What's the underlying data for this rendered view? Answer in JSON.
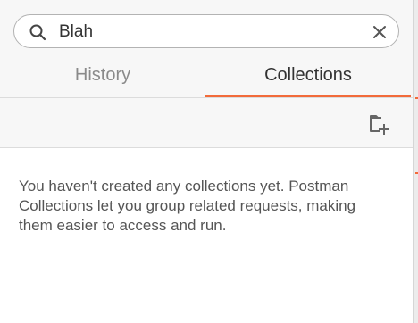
{
  "search": {
    "value": "Blah",
    "icon": "search-icon",
    "clear_icon": "close-icon"
  },
  "tabs": [
    {
      "label": "History",
      "active": false
    },
    {
      "label": "Collections",
      "active": true
    }
  ],
  "toolbar": {
    "new_collection_icon": "add-folder-icon"
  },
  "empty_state": {
    "message": "You haven't created any collections yet. Postman Collections let you group related requests, making them easier to access and run."
  },
  "colors": {
    "accent": "#f26b3a",
    "header_bg": "#f7f7f7",
    "text_muted": "#8a8a8a",
    "text": "#555555"
  }
}
